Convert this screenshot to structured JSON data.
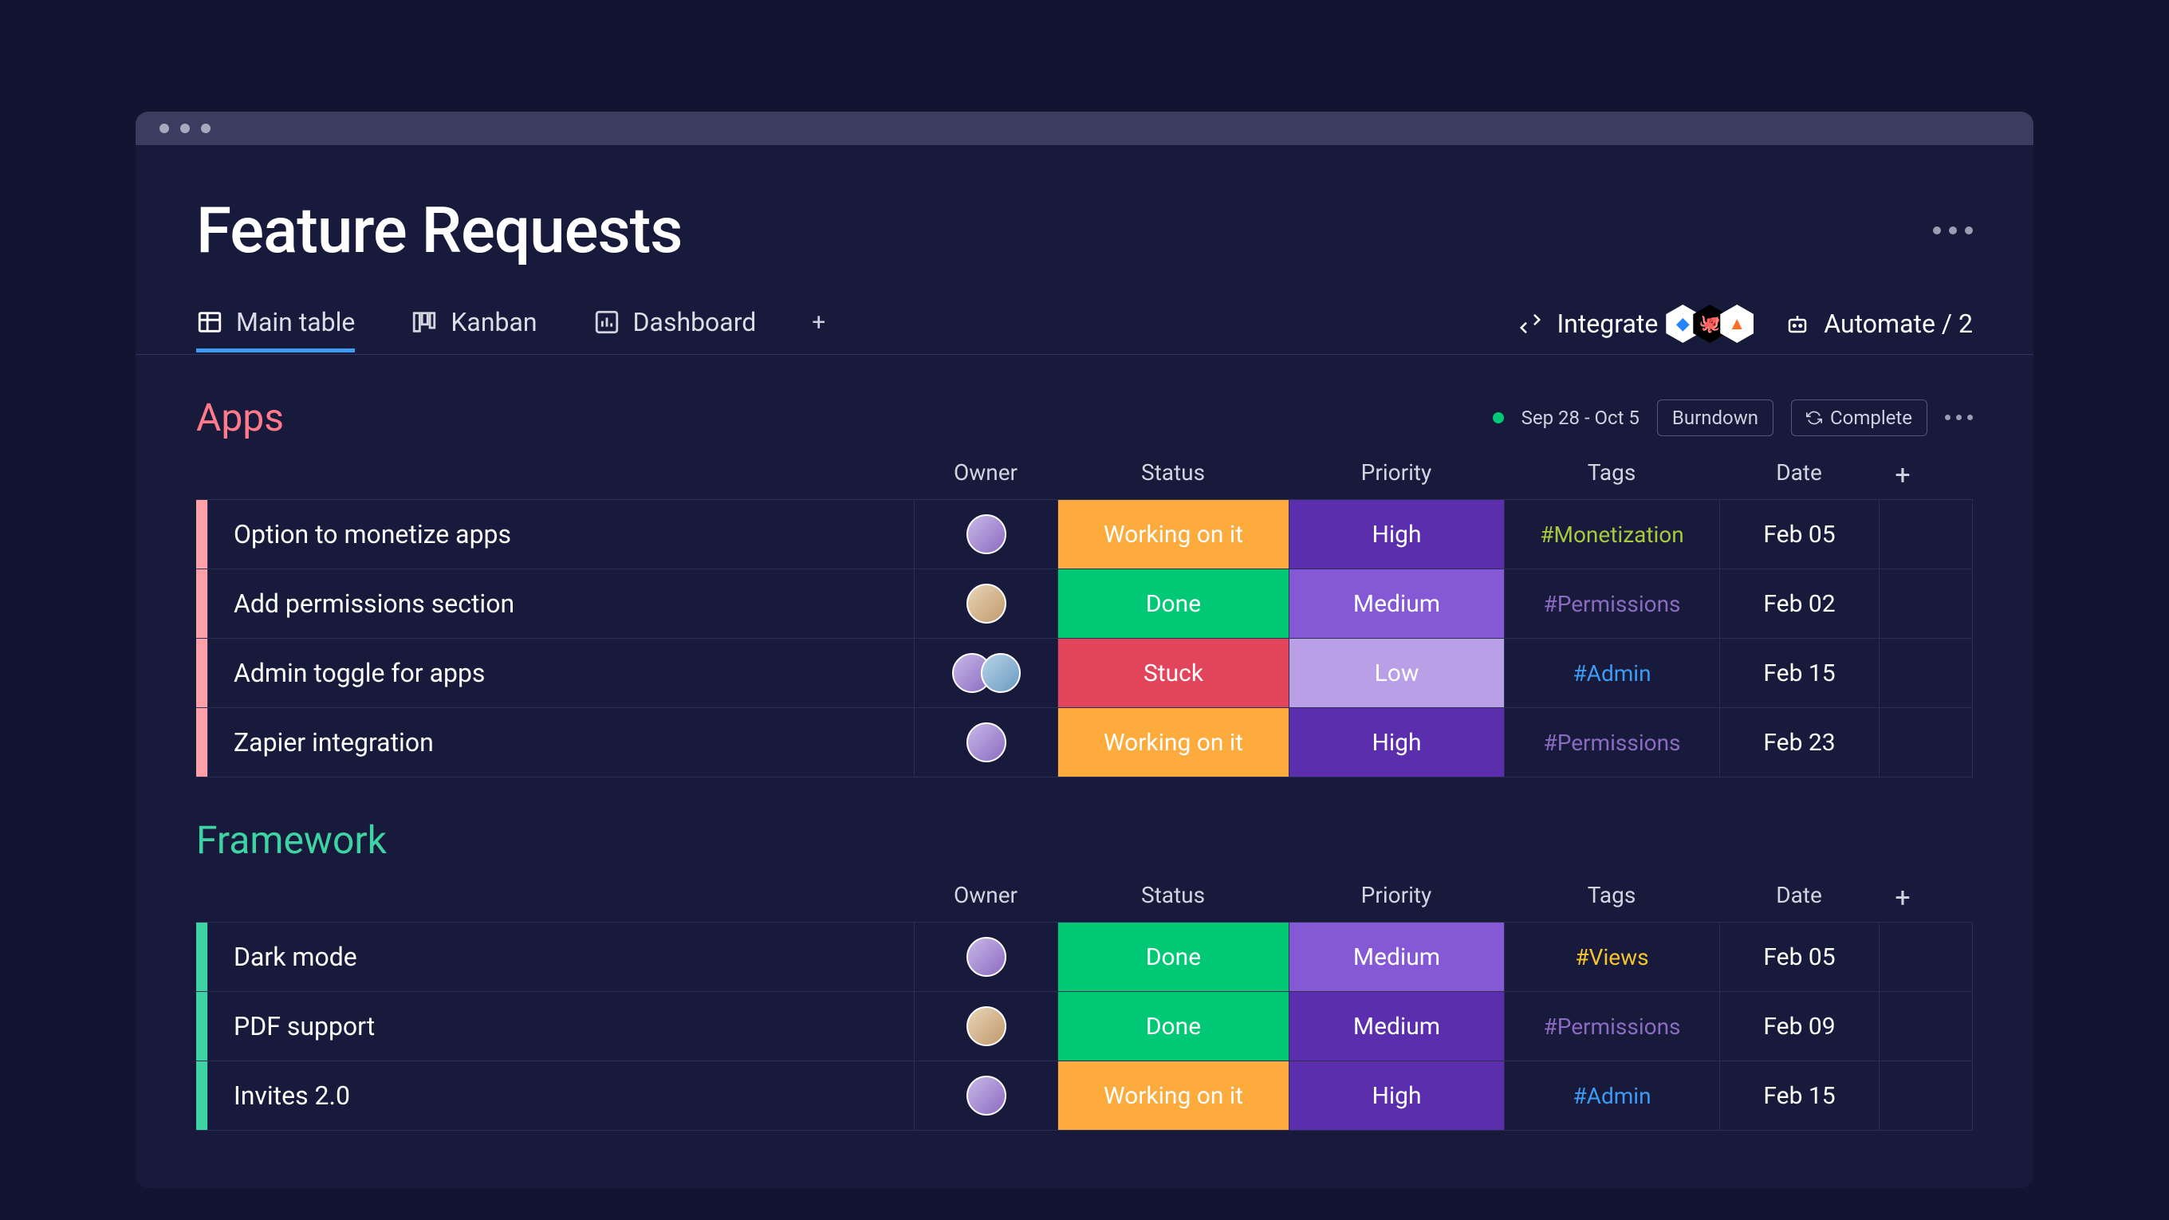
{
  "page": {
    "title": "Feature Requests"
  },
  "tabs": [
    {
      "label": "Main table",
      "icon": "table"
    },
    {
      "label": "Kanban",
      "icon": "kanban"
    },
    {
      "label": "Dashboard",
      "icon": "chart"
    }
  ],
  "actions": {
    "integrate": "Integrate",
    "automate": "Automate / 2"
  },
  "groups": [
    {
      "name": "Apps",
      "color": "#FF7A8A",
      "accent": "#FF9FA8",
      "dateRange": "Sep 28 - Oct 5",
      "tools": {
        "burndown": "Burndown",
        "complete": "Complete"
      },
      "columns": [
        "Owner",
        "Status",
        "Priority",
        "Tags",
        "Date"
      ],
      "rows": [
        {
          "name": "Option to monetize apps",
          "owners": [
            "a1"
          ],
          "status": "Working on it",
          "statusColor": "#FDAB3D",
          "priority": "High",
          "priorityColor": "#5B2EAE",
          "tag": "#Monetization",
          "tagColor": "#A8C93C",
          "date": "Feb 05"
        },
        {
          "name": "Add permissions section",
          "owners": [
            "a2"
          ],
          "status": "Done",
          "statusColor": "#00C875",
          "priority": "Medium",
          "priorityColor": "#8559D6",
          "tag": "#Permissions",
          "tagColor": "#8A6BC1",
          "date": "Feb 02"
        },
        {
          "name": "Admin toggle for apps",
          "owners": [
            "a1",
            "a3"
          ],
          "status": "Stuck",
          "statusColor": "#E2445C",
          "priority": "Low",
          "priorityColor": "#B89FE6",
          "tag": "#Admin",
          "tagColor": "#3E9BF3",
          "date": "Feb 15"
        },
        {
          "name": "Zapier integration",
          "owners": [
            "a1"
          ],
          "status": "Working on it",
          "statusColor": "#FDAB3D",
          "priority": "High",
          "priorityColor": "#5B2EAE",
          "tag": "#Permissions",
          "tagColor": "#8A6BC1",
          "date": "Feb 23"
        }
      ]
    },
    {
      "name": "Framework",
      "color": "#3ED3A3",
      "accent": "#3ED3A3",
      "columns": [
        "Owner",
        "Status",
        "Priority",
        "Tags",
        "Date"
      ],
      "rows": [
        {
          "name": "Dark mode",
          "owners": [
            "a1"
          ],
          "status": "Done",
          "statusColor": "#00C875",
          "priority": "Medium",
          "priorityColor": "#8559D6",
          "tag": "#Views",
          "tagColor": "#F4C430",
          "date": "Feb 05"
        },
        {
          "name": "PDF support",
          "owners": [
            "a2"
          ],
          "status": "Done",
          "statusColor": "#00C875",
          "priority": "Medium",
          "priorityColor": "#5B2EAE",
          "tag": "#Permissions",
          "tagColor": "#8A6BC1",
          "date": "Feb 09"
        },
        {
          "name": "Invites 2.0",
          "owners": [
            "a1"
          ],
          "status": "Working on it",
          "statusColor": "#FDAB3D",
          "priority": "High",
          "priorityColor": "#5B2EAE",
          "tag": "#Admin",
          "tagColor": "#3E9BF3",
          "date": "Feb 15"
        }
      ]
    }
  ]
}
